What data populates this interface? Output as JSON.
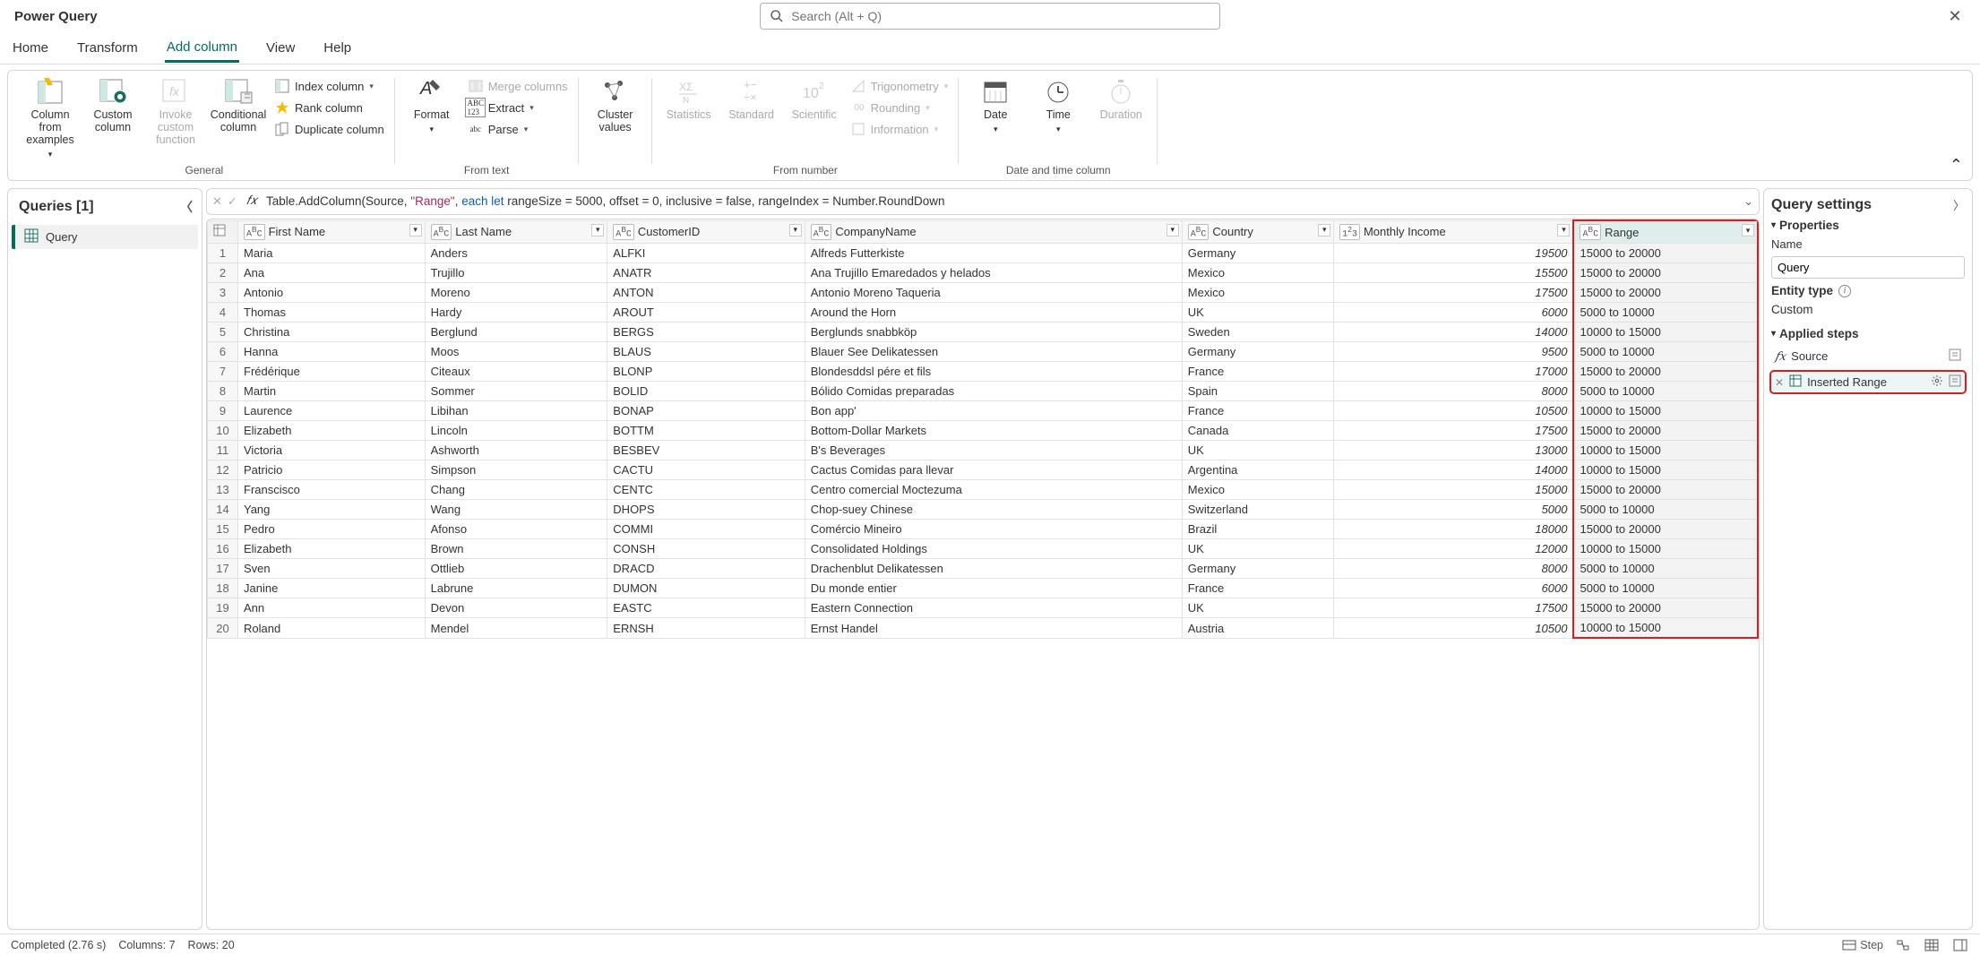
{
  "app_title": "Power Query",
  "search_placeholder": "Search (Alt + Q)",
  "tabs": {
    "home": "Home",
    "transform": "Transform",
    "addcolumn": "Add column",
    "view": "View",
    "help": "Help"
  },
  "ribbon": {
    "general": {
      "label": "General",
      "column_from_examples": "Column from examples",
      "custom_column": "Custom column",
      "invoke_custom_function": "Invoke custom function",
      "conditional_column": "Conditional column",
      "index_column": "Index column",
      "rank_column": "Rank column",
      "duplicate_column": "Duplicate column"
    },
    "from_text": {
      "label": "From text",
      "format": "Format",
      "merge_columns": "Merge columns",
      "extract": "Extract",
      "parse": "Parse"
    },
    "cluster_values": "Cluster values",
    "from_number": {
      "label": "From number",
      "statistics": "Statistics",
      "standard": "Standard",
      "scientific": "Scientific",
      "trigonometry": "Trigonometry",
      "rounding": "Rounding",
      "information": "Information"
    },
    "date_time": {
      "label": "Date and time column",
      "date": "Date",
      "time": "Time",
      "duration": "Duration"
    }
  },
  "queries": {
    "header": "Queries [1]",
    "items": [
      {
        "label": "Query"
      }
    ]
  },
  "formula_prefix": "Table.AddColumn(Source, ",
  "formula_string": "\"Range\"",
  "formula_mid1": ", ",
  "formula_kw": "each let",
  "formula_rest": " rangeSize = 5000, offset = 0, inclusive = false, rangeIndex = Number.RoundDown",
  "columns": [
    {
      "name": "First Name",
      "type": "ABC"
    },
    {
      "name": "Last Name",
      "type": "ABC"
    },
    {
      "name": "CustomerID",
      "type": "ABC"
    },
    {
      "name": "CompanyName",
      "type": "ABC"
    },
    {
      "name": "Country",
      "type": "ABC"
    },
    {
      "name": "Monthly Income",
      "type": "123"
    },
    {
      "name": "Range",
      "type": "ABC"
    }
  ],
  "rows": [
    [
      "Maria",
      "Anders",
      "ALFKI",
      "Alfreds Futterkiste",
      "Germany",
      "19500",
      "15000 to 20000"
    ],
    [
      "Ana",
      "Trujillo",
      "ANATR",
      "Ana Trujillo Emaredados y helados",
      "Mexico",
      "15500",
      "15000 to 20000"
    ],
    [
      "Antonio",
      "Moreno",
      "ANTON",
      "Antonio Moreno Taqueria",
      "Mexico",
      "17500",
      "15000 to 20000"
    ],
    [
      "Thomas",
      "Hardy",
      "AROUT",
      "Around the Horn",
      "UK",
      "6000",
      "5000 to 10000"
    ],
    [
      "Christina",
      "Berglund",
      "BERGS",
      "Berglunds snabbköp",
      "Sweden",
      "14000",
      "10000 to 15000"
    ],
    [
      "Hanna",
      "Moos",
      "BLAUS",
      "Blauer See Delikatessen",
      "Germany",
      "9500",
      "5000 to 10000"
    ],
    [
      "Frédérique",
      "Citeaux",
      "BLONP",
      "Blondesddsl pére et fils",
      "France",
      "17000",
      "15000 to 20000"
    ],
    [
      "Martin",
      "Sommer",
      "BOLID",
      "Bólido Comidas preparadas",
      "Spain",
      "8000",
      "5000 to 10000"
    ],
    [
      "Laurence",
      "Libihan",
      "BONAP",
      "Bon app'",
      "France",
      "10500",
      "10000 to 15000"
    ],
    [
      "Elizabeth",
      "Lincoln",
      "BOTTM",
      "Bottom-Dollar Markets",
      "Canada",
      "17500",
      "15000 to 20000"
    ],
    [
      "Victoria",
      "Ashworth",
      "BESBEV",
      "B's Beverages",
      "UK",
      "13000",
      "10000 to 15000"
    ],
    [
      "Patricio",
      "Simpson",
      "CACTU",
      "Cactus Comidas para llevar",
      "Argentina",
      "14000",
      "10000 to 15000"
    ],
    [
      "Franscisco",
      "Chang",
      "CENTC",
      "Centro comercial Moctezuma",
      "Mexico",
      "15000",
      "15000 to 20000"
    ],
    [
      "Yang",
      "Wang",
      "DHOPS",
      "Chop-suey Chinese",
      "Switzerland",
      "5000",
      "5000 to 10000"
    ],
    [
      "Pedro",
      "Afonso",
      "COMMI",
      "Comércio Mineiro",
      "Brazil",
      "18000",
      "15000 to 20000"
    ],
    [
      "Elizabeth",
      "Brown",
      "CONSH",
      "Consolidated Holdings",
      "UK",
      "12000",
      "10000 to 15000"
    ],
    [
      "Sven",
      "Ottlieb",
      "DRACD",
      "Drachenblut Delikatessen",
      "Germany",
      "8000",
      "5000 to 10000"
    ],
    [
      "Janine",
      "Labrune",
      "DUMON",
      "Du monde entier",
      "France",
      "6000",
      "5000 to 10000"
    ],
    [
      "Ann",
      "Devon",
      "EASTC",
      "Eastern Connection",
      "UK",
      "17500",
      "15000 to 20000"
    ],
    [
      "Roland",
      "Mendel",
      "ERNSH",
      "Ernst Handel",
      "Austria",
      "10500",
      "10000 to 15000"
    ]
  ],
  "settings": {
    "title": "Query settings",
    "properties": "Properties",
    "name_label": "Name",
    "name_value": "Query",
    "entity_type_label": "Entity type",
    "entity_type_value": "Custom",
    "applied_steps": "Applied steps",
    "steps": [
      {
        "label": "Source",
        "fx": true
      },
      {
        "label": "Inserted Range",
        "fx": false
      }
    ]
  },
  "status": {
    "completed": "Completed (2.76 s)",
    "columns": "Columns: 7",
    "rows": "Rows: 20",
    "step_btn": "Step"
  }
}
